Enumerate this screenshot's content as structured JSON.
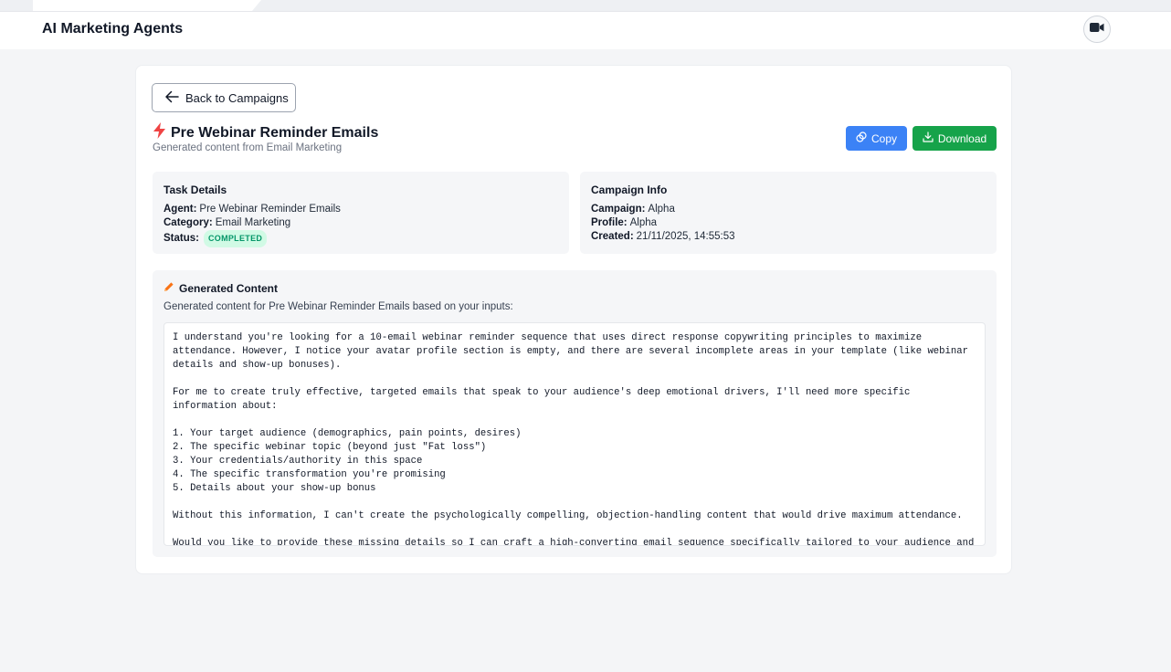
{
  "header": {
    "app_title": "AI Marketing Agents",
    "video_icon": "video-camera-icon"
  },
  "page": {
    "back_label": "Back to Campaigns",
    "title": "Pre Webinar Reminder Emails",
    "title_icon": "lightning-bolt-icon",
    "subtitle": "Generated content from Email Marketing",
    "copy_label": "Copy",
    "download_label": "Download"
  },
  "task_details": {
    "heading": "Task Details",
    "agent_label": "Agent:",
    "agent_value": "Pre Webinar Reminder Emails",
    "category_label": "Category:",
    "category_value": "Email Marketing",
    "status_label": "Status:",
    "status_value": "COMPLETED"
  },
  "campaign_info": {
    "heading": "Campaign Info",
    "campaign_label": "Campaign:",
    "campaign_value": "Alpha",
    "profile_label": "Profile:",
    "profile_value": "Alpha",
    "created_label": "Created:",
    "created_value": "21/11/2025, 14:55:53"
  },
  "generated": {
    "heading": "Generated Content",
    "description": "Generated content for Pre Webinar Reminder Emails based on your inputs:",
    "content": "I understand you're looking for a 10-email webinar reminder sequence that uses direct response copywriting principles to maximize attendance. However, I notice your avatar profile section is empty, and there are several incomplete areas in your template (like webinar details and show-up bonuses).\n\nFor me to create truly effective, targeted emails that speak to your audience's deep emotional drivers, I'll need more specific information about:\n\n1. Your target audience (demographics, pain points, desires)\n2. The specific webinar topic (beyond just \"Fat loss\")\n3. Your credentials/authority in this space\n4. The specific transformation you're promising\n5. Details about your show-up bonus\n\nWithout this information, I can't create the psychologically compelling, objection-handling content that would drive maximum attendance.\n\nWould you like to provide these missing details so I can craft a high-converting email sequence specifically tailored to your audience and offer? This would allow me to address their true emotional drivers and objections rather than creating generic content."
  },
  "colors": {
    "primary_blue": "#3b82f6",
    "download_green": "#16a34a",
    "bolt_red": "#ef4444",
    "pencil_orange": "#f97316",
    "badge_bg": "#d1fae5",
    "badge_text": "#059669"
  }
}
